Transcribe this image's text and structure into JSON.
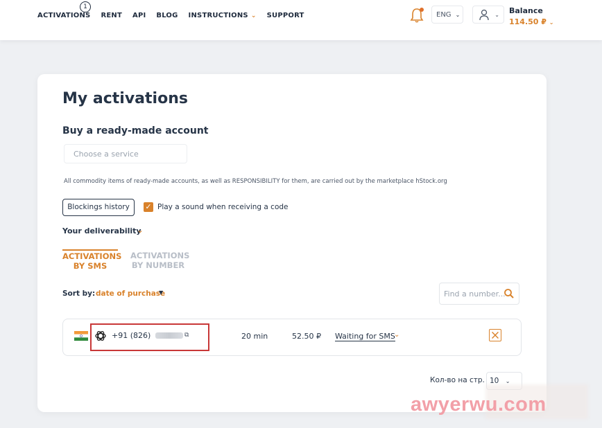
{
  "nav": {
    "items": [
      "ACTIVATIONS",
      "RENT",
      "API",
      "BLOG",
      "INSTRUCTIONS",
      "SUPPORT"
    ],
    "activations_badge": "1",
    "language": "ENG",
    "balance_label": "Balance",
    "balance_amount": "114.50 ₽"
  },
  "main": {
    "title": "My activations",
    "subtitle": "Buy a ready-made account",
    "service_placeholder": "Choose a service",
    "note": "All commodity items of ready-made accounts, as well as RESPONSIBILITY for them, are carried out by the marketplace hStock.org",
    "blockings_button": "Blockings history",
    "sound_checkbox_label": "Play a sound when receiving a code",
    "sound_checked": true,
    "deliverability_label": "Your deliverability",
    "tabs": [
      {
        "line1": "ACTIVATIONS",
        "line2": "BY SMS",
        "active": true
      },
      {
        "line1": "ACTIVATIONS",
        "line2": "BY NUMBER",
        "active": false
      }
    ],
    "sort_label": "Sort by:",
    "sort_value": "date of purchase",
    "find_placeholder": "Find a number...",
    "activation": {
      "country": "India",
      "service_icon": "openai-icon",
      "phone": "+91 (826)",
      "time": "20 min",
      "price": "52.50 ₽",
      "status": "Waiting for SMS"
    },
    "per_page_label": "Кол-во на стр.",
    "per_page_value": "10"
  },
  "watermark": "awyerwu.com",
  "colors": {
    "accent": "#d9822b",
    "text": "#263447",
    "highlight_box": "#c83737"
  }
}
